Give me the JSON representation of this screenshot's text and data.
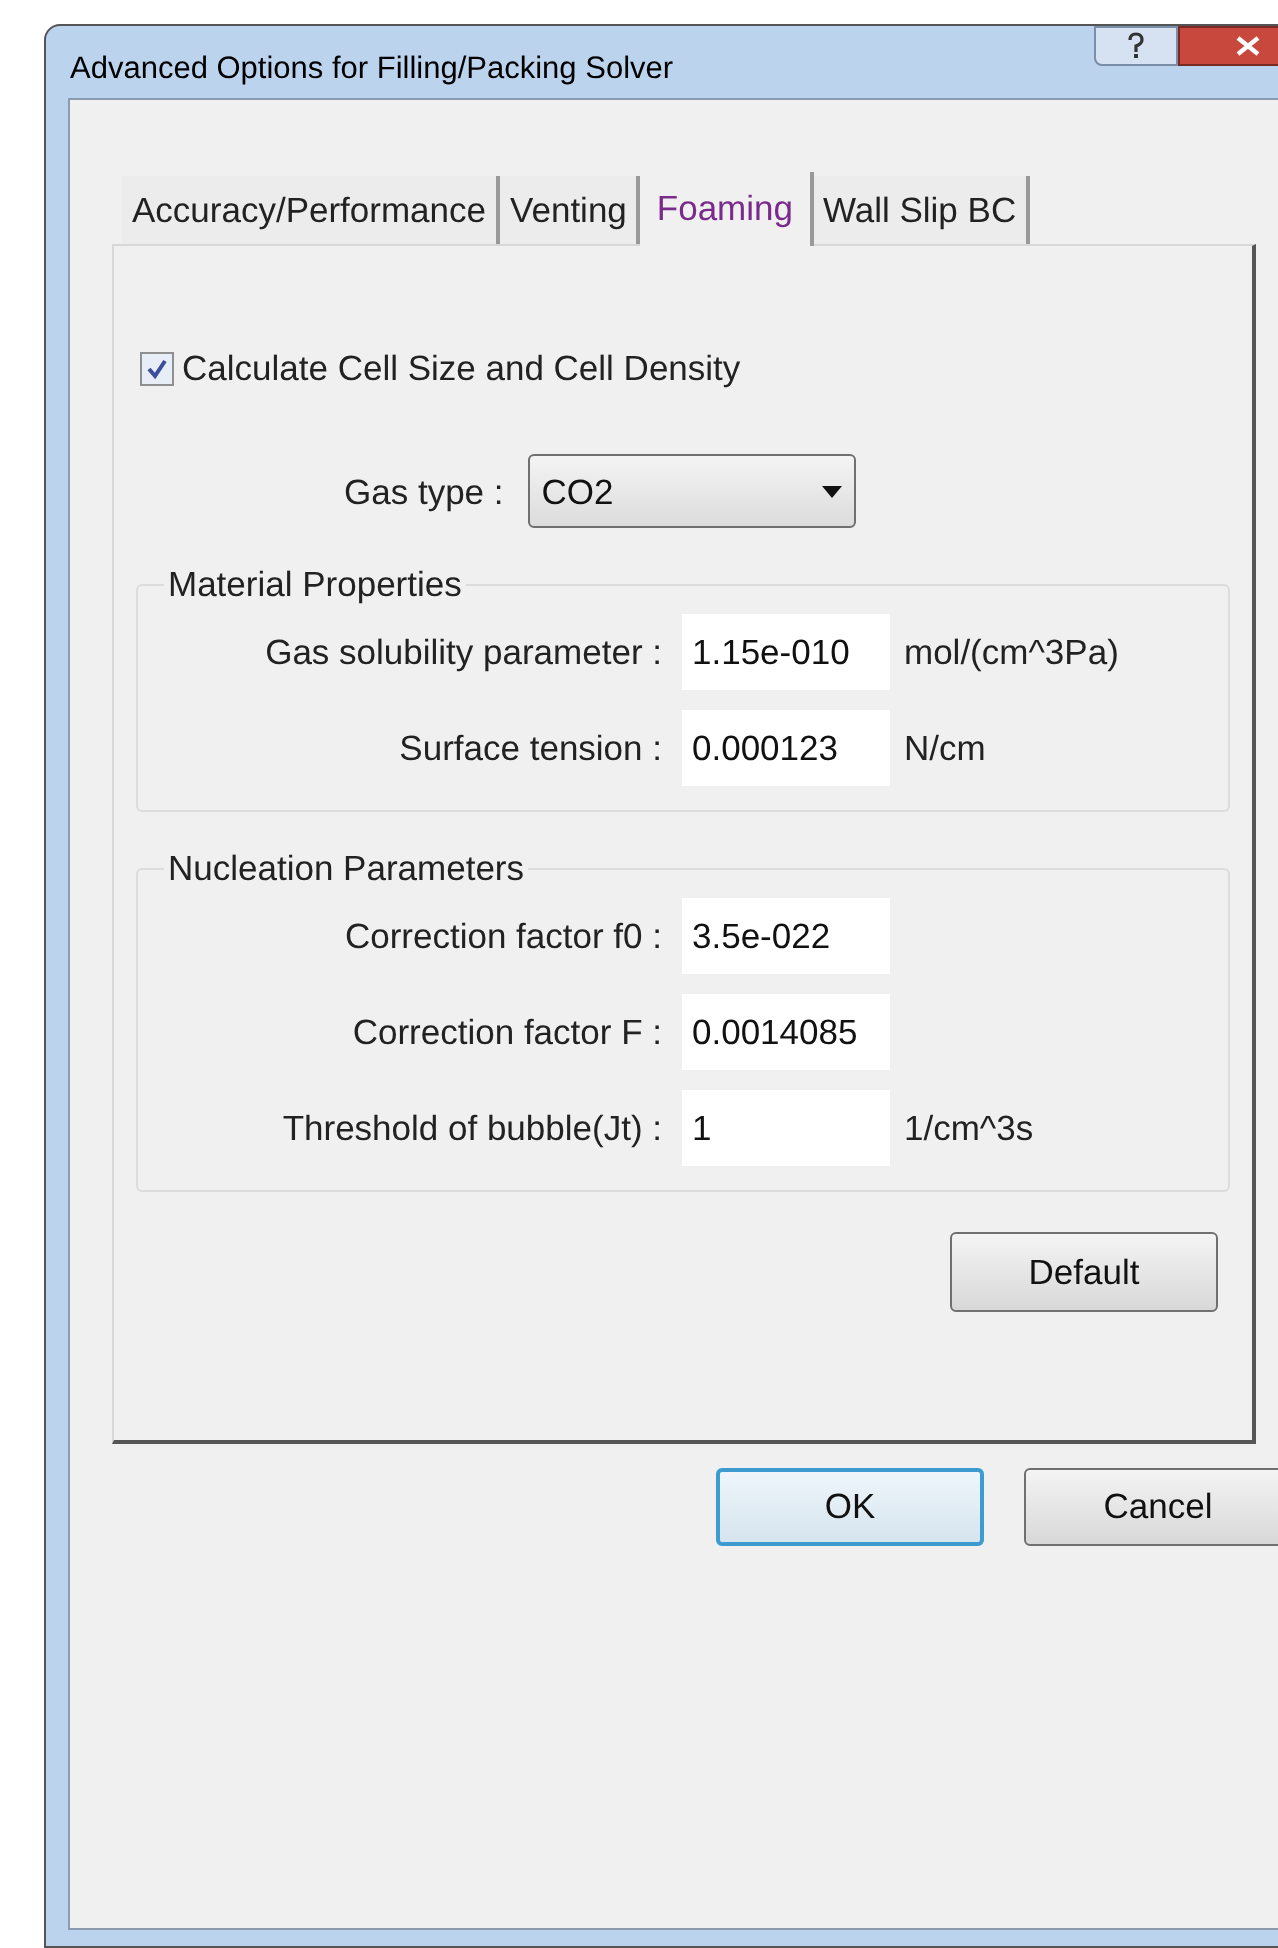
{
  "window": {
    "title": "Advanced Options for Filling/Packing Solver"
  },
  "tabs": [
    {
      "label": "Accuracy/Performance",
      "selected": false
    },
    {
      "label": "Venting",
      "selected": false
    },
    {
      "label": "Foaming",
      "selected": true
    },
    {
      "label": "Wall Slip BC",
      "selected": false
    }
  ],
  "checkbox": {
    "label": "Calculate Cell Size and Cell Density",
    "checked": true
  },
  "gas_type": {
    "label": "Gas type :",
    "value": "CO2"
  },
  "groups": [
    {
      "title": "Material Properties",
      "fields": [
        {
          "label": "Gas solubility parameter :",
          "value": "1.15e-010",
          "unit": "mol/(cm^3Pa)"
        },
        {
          "label": "Surface tension :",
          "value": "0.000123",
          "unit": "N/cm"
        }
      ]
    },
    {
      "title": "Nucleation Parameters",
      "fields": [
        {
          "label": "Correction factor f0 :",
          "value": "3.5e-022"
        },
        {
          "label": "Correction factor F :",
          "value": "0.0014085"
        },
        {
          "label": "Threshold of bubble(Jt) :",
          "value": "1",
          "unit": "1/cm^3s"
        }
      ]
    }
  ],
  "default_button": "Default",
  "buttons": [
    {
      "label": "OK",
      "selected": true
    },
    {
      "label": "Cancel",
      "selected": false
    }
  ]
}
